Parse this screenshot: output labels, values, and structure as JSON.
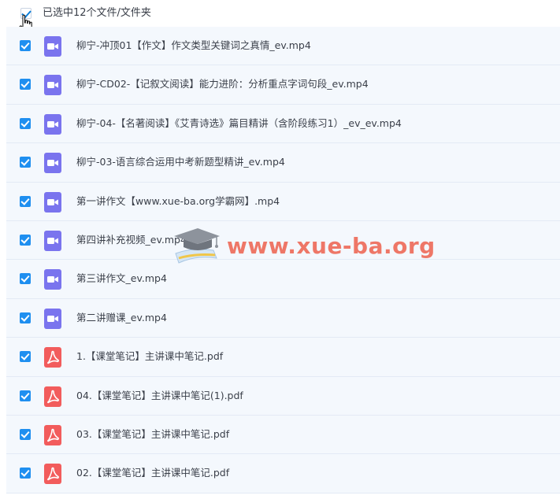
{
  "header": {
    "selection_text": "已选中12个文件/文件夹"
  },
  "files": [
    {
      "name": "柳宁-冲顶01【作文】作文类型关键词之真情_ev.mp4",
      "type": "video-icon"
    },
    {
      "name": "柳宁-CD02-【记叙文阅读】能力进阶：分析重点字词句段_ev.mp4",
      "type": "video-icon"
    },
    {
      "name": "柳宁-04-【名著阅读】《艾青诗选》篇目精讲（含阶段练习1）_ev_ev.mp4",
      "type": "video-icon"
    },
    {
      "name": "柳宁-03-语言综合运用中考新题型精讲_ev.mp4",
      "type": "video-icon"
    },
    {
      "name": "第一讲作文【www.xue-ba.org学霸网】.mp4",
      "type": "video-icon"
    },
    {
      "name": "第四讲补充视频_ev.mp4",
      "type": "video-icon"
    },
    {
      "name": "第三讲作文_ev.mp4",
      "type": "video-icon"
    },
    {
      "name": "第二讲赠课_ev.mp4",
      "type": "video-icon"
    },
    {
      "name": "1.【课堂笔记】主讲课中笔记.pdf",
      "type": "pdf-icon"
    },
    {
      "name": "04.【课堂笔记】主讲课中笔记(1).pdf",
      "type": "pdf-icon"
    },
    {
      "name": "03.【课堂笔记】主讲课中笔记.pdf",
      "type": "pdf-icon"
    },
    {
      "name": "02.【课堂笔记】主讲课中笔记.pdf",
      "type": "pdf-icon"
    }
  ],
  "watermark": {
    "text": "www.xue-ba.org"
  },
  "colors": {
    "accent": "#1f8ff0",
    "video_icon": "#7a74ee",
    "pdf_icon": "#f25c5c",
    "row_bg": "#f4f8fd",
    "watermark": "#ec604c"
  }
}
